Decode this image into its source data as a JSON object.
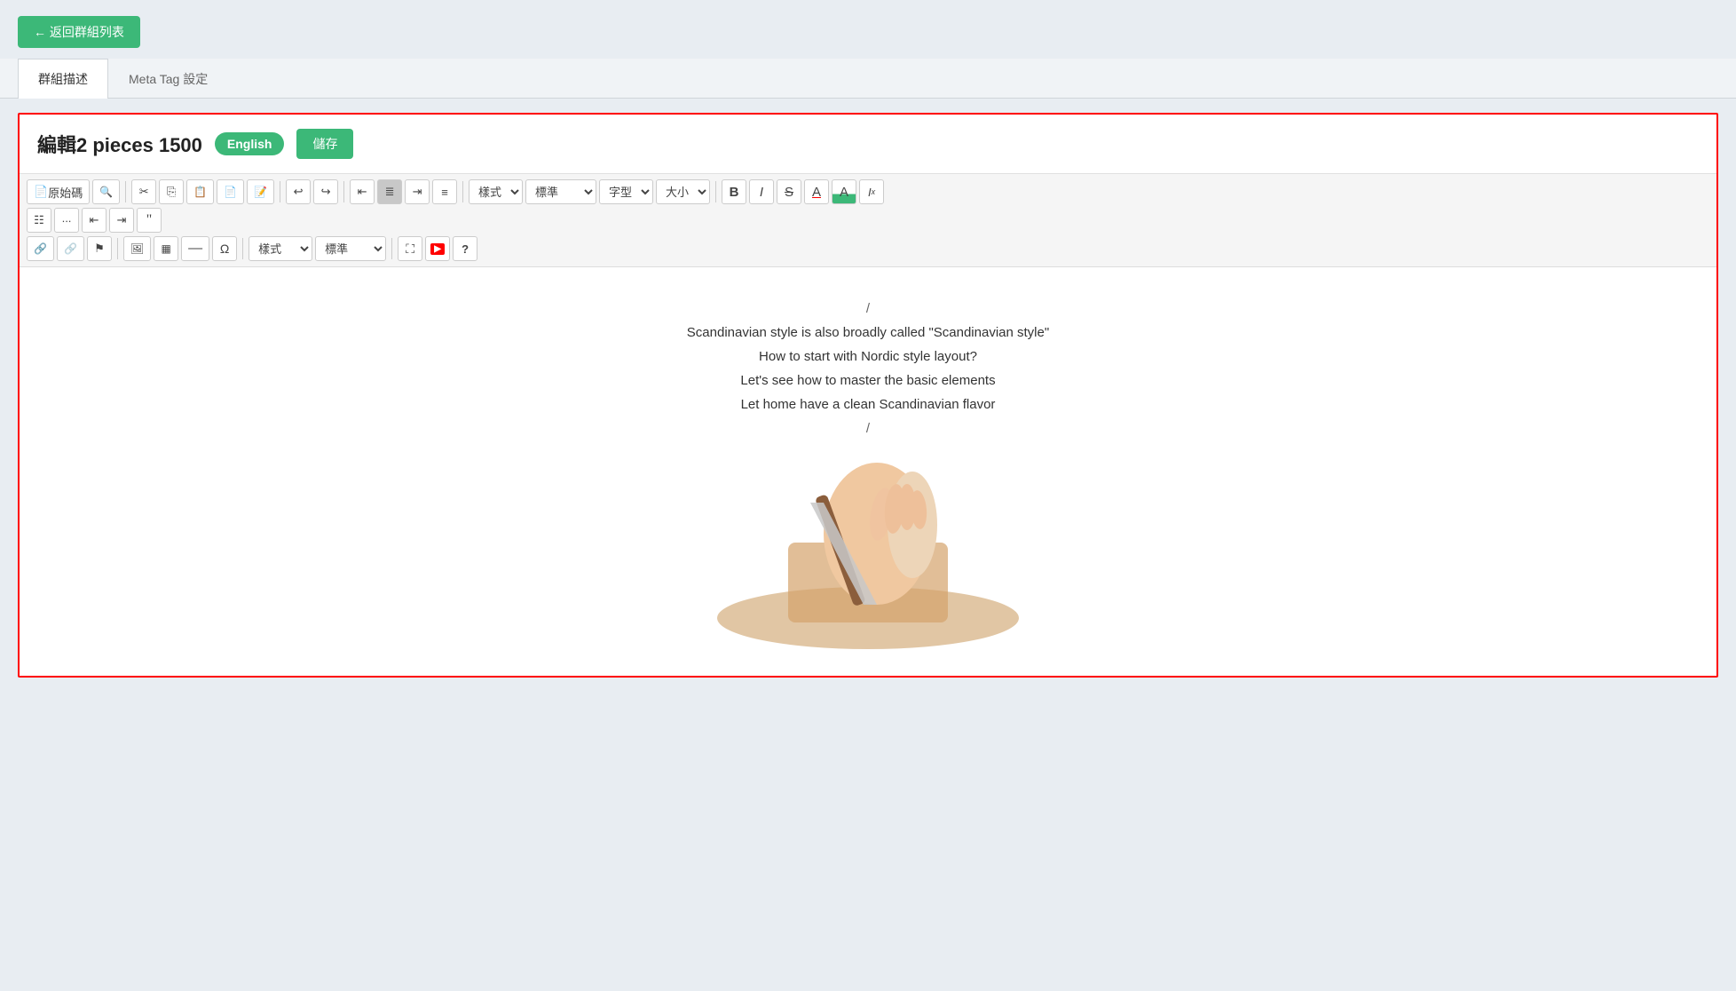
{
  "back_button": "← 返回群組列表",
  "tabs": [
    {
      "id": "description",
      "label": "群組描述",
      "active": true
    },
    {
      "id": "metatag",
      "label": "Meta Tag 設定",
      "active": false
    }
  ],
  "editor": {
    "title": "編輯2 pieces 1500",
    "lang_badge": "English",
    "save_label": "儲存",
    "toolbar": {
      "row1": [
        {
          "id": "source",
          "label": "原始碼",
          "icon": "📄"
        },
        {
          "id": "search-replace",
          "label": "🔍",
          "icon": ""
        },
        {
          "id": "cut",
          "label": "✂",
          "icon": ""
        },
        {
          "id": "copy",
          "label": "⎘",
          "icon": ""
        },
        {
          "id": "paste",
          "label": "📋",
          "icon": ""
        },
        {
          "id": "paste-text",
          "label": "📄",
          "icon": ""
        },
        {
          "id": "paste-word",
          "label": "📝",
          "icon": ""
        },
        {
          "id": "undo",
          "label": "↩",
          "icon": ""
        },
        {
          "id": "redo",
          "label": "↪",
          "icon": ""
        },
        {
          "id": "align-left",
          "label": "≡",
          "icon": ""
        },
        {
          "id": "align-center",
          "label": "≡",
          "icon": "",
          "active": true
        },
        {
          "id": "align-right",
          "label": "≡",
          "icon": ""
        },
        {
          "id": "align-justify",
          "label": "≡",
          "icon": ""
        },
        {
          "id": "style-select",
          "type": "select",
          "value": "樣式"
        },
        {
          "id": "format-select",
          "type": "select",
          "value": "標準"
        },
        {
          "id": "font-select",
          "type": "select",
          "value": "字型"
        },
        {
          "id": "size-select",
          "type": "select",
          "value": "大小"
        },
        {
          "id": "bold",
          "label": "B",
          "icon": ""
        },
        {
          "id": "italic",
          "label": "I",
          "icon": ""
        },
        {
          "id": "strike",
          "label": "S",
          "icon": ""
        },
        {
          "id": "font-color",
          "label": "A",
          "icon": ""
        },
        {
          "id": "bg-color",
          "label": "A",
          "icon": ""
        },
        {
          "id": "clear-format",
          "label": "Ix",
          "icon": ""
        }
      ],
      "row2": [
        {
          "id": "ordered-list",
          "label": "≡",
          "icon": ""
        },
        {
          "id": "unordered-list",
          "label": "≡",
          "icon": ""
        },
        {
          "id": "indent-less",
          "label": "⇤",
          "icon": ""
        },
        {
          "id": "indent-more",
          "label": "⇥",
          "icon": ""
        },
        {
          "id": "blockquote",
          "label": "❝",
          "icon": ""
        }
      ],
      "row3": [
        {
          "id": "link",
          "label": "🔗",
          "icon": ""
        },
        {
          "id": "unlink",
          "label": "🔗",
          "icon": ""
        },
        {
          "id": "anchor",
          "label": "⚑",
          "icon": ""
        },
        {
          "id": "image",
          "label": "🖼",
          "icon": ""
        },
        {
          "id": "table",
          "label": "▦",
          "icon": ""
        },
        {
          "id": "hr",
          "label": "—",
          "icon": ""
        },
        {
          "id": "special-chars",
          "label": "Ω",
          "icon": ""
        },
        {
          "id": "style-select2",
          "type": "select",
          "value": "樣式"
        },
        {
          "id": "format-select2",
          "type": "select",
          "value": "標準"
        },
        {
          "id": "fullscreen",
          "label": "⛶",
          "icon": ""
        },
        {
          "id": "youtube",
          "label": "YT",
          "icon": ""
        },
        {
          "id": "help",
          "label": "?",
          "icon": ""
        }
      ]
    },
    "content": {
      "lines": [
        {
          "type": "slash",
          "text": "/"
        },
        {
          "type": "text",
          "text": "Scandinavian style is also broadly called \"Scandinavian style\""
        },
        {
          "type": "text",
          "text": "How to start with Nordic style layout?"
        },
        {
          "type": "text",
          "text": "Let's see how to master the basic elements"
        },
        {
          "type": "text",
          "text": "Let home have a clean Scandinavian flavor"
        },
        {
          "type": "slash",
          "text": "/"
        }
      ]
    }
  }
}
